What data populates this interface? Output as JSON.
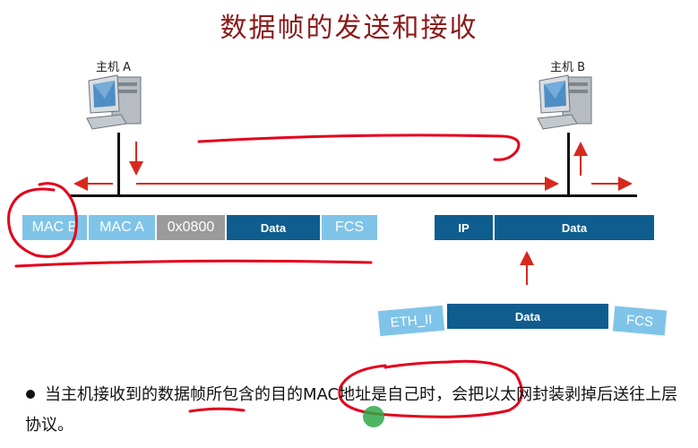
{
  "title": "数据帧的发送和接收",
  "host_a": {
    "label": "主机 A"
  },
  "host_b": {
    "label": "主机 B"
  },
  "sent_frame": {
    "fields": [
      "MAC B",
      "MAC A",
      "0x0800",
      "Data",
      "FCS"
    ]
  },
  "received_packet": {
    "fields": [
      "IP",
      "Data"
    ]
  },
  "stripped_frame": {
    "fields": [
      "ETH_II",
      "Data",
      "FCS"
    ]
  },
  "bullet": {
    "text": "当主机接收到的数据帧所包含的目的MAC地址是自己时，会把以太网封装剥掉后送往上层协议。"
  },
  "colors": {
    "title": "#8b1a1a",
    "field_light": "#7fc4e8",
    "field_dark": "#0f5d8f",
    "field_gray": "#9b9b9b",
    "arrow_red": "#d8281e",
    "annotation_red": "#e3001b"
  }
}
